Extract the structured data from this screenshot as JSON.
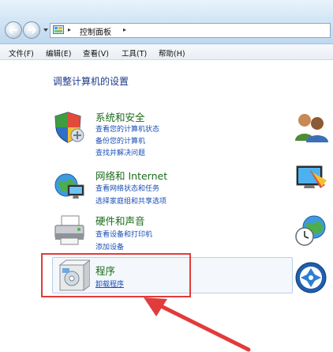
{
  "window": {
    "address_crumb": "控制面板",
    "address_sep_1": "▸",
    "address_sep_2": "▸"
  },
  "menubar": {
    "items": [
      "文件(F)",
      "编辑(E)",
      "查看(V)",
      "工具(T)",
      "帮助(H)"
    ]
  },
  "page_title": "调整计算机的设置",
  "categories": [
    {
      "title": "系统和安全",
      "icon": "shield-icon",
      "links": [
        "查看您的计算机状态",
        "备份您的计算机",
        "查找并解决问题"
      ]
    },
    {
      "title": "网络和 Internet",
      "icon": "network-globe-icon",
      "links": [
        "查看网络状态和任务",
        "选择家庭组和共享选项"
      ]
    },
    {
      "title": "硬件和声音",
      "icon": "printer-icon",
      "links": [
        "查看设备和打印机",
        "添加设备"
      ]
    },
    {
      "title": "程序",
      "icon": "programs-icon",
      "links": [
        "卸载程序"
      ]
    }
  ],
  "right_column_icons": [
    "user-accounts-icon",
    "appearance-icon",
    "clock-globe-icon",
    "ease-of-access-icon"
  ],
  "colors": {
    "category_title": "#1b6b1b",
    "link": "#1a4fb5",
    "page_title": "#1e3a8a",
    "highlight_box": "#e23b3b",
    "arrow": "#e23b3b"
  }
}
